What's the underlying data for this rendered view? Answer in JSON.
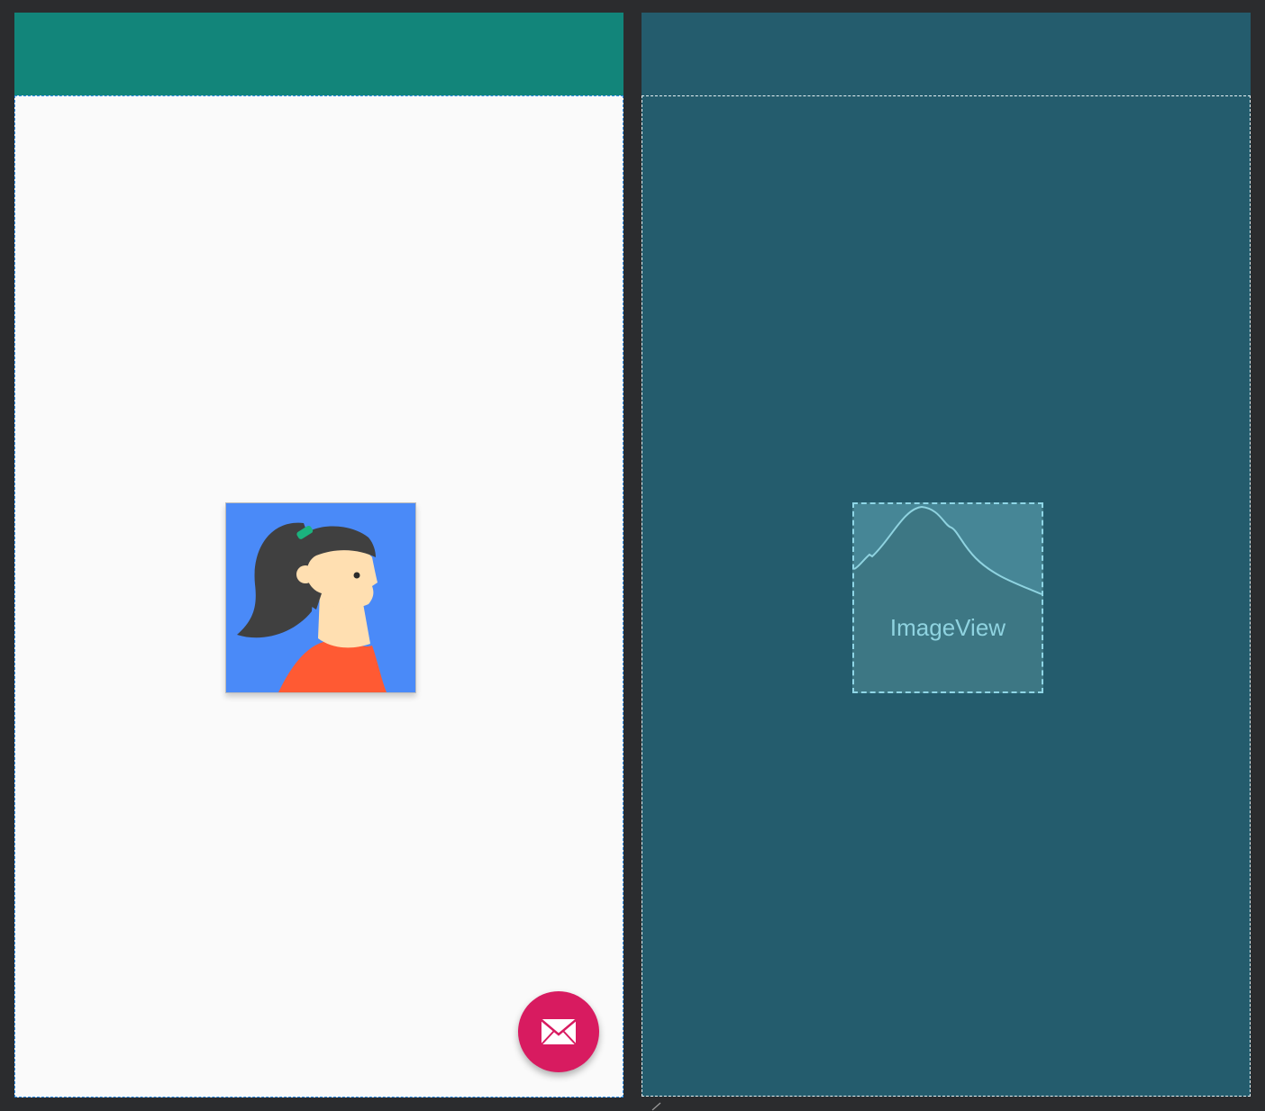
{
  "design_preview": {
    "appbar_color": "#12857a",
    "content_color": "#fafafa",
    "image": {
      "icon": "avatar-woman-icon",
      "background_color": "#4a8af8"
    },
    "fab": {
      "icon": "mail-icon",
      "color": "#d81b60"
    }
  },
  "blueprint_preview": {
    "appbar_color": "#245c6d",
    "background_color": "#245c6d",
    "image_placeholder": {
      "icon": "image-placeholder-icon",
      "label": "ImageView"
    }
  }
}
